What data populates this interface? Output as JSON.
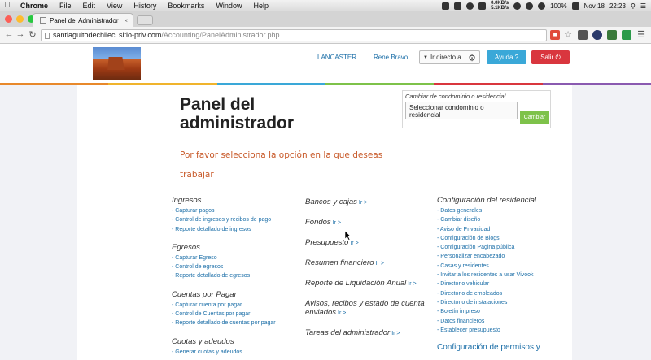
{
  "menubar": {
    "app": "Chrome",
    "items": [
      "File",
      "Edit",
      "View",
      "History",
      "Bookmarks",
      "Window",
      "Help"
    ],
    "net_up": "0.0KB/s",
    "net_down": "5.1KB/s",
    "battery": "100%",
    "date": "Nov 18",
    "time": "22:23"
  },
  "browser": {
    "tab_title": "Panel del Administrador",
    "url_host": "santiaguitodechilecl.sitio-priv.com",
    "url_path": "/Accounting/PanelAdministrador.php"
  },
  "header": {
    "link1": "LANCASTER",
    "link2": "Rene Bravo",
    "goto_label": "Ir directo a",
    "help_label": "Ayuda ?",
    "exit_label": "Salir"
  },
  "colors": {
    "stripe": [
      "#e8892b",
      "#f0b42d",
      "#3aa8d8",
      "#7ec24a",
      "#d9363e",
      "#8a5ab0"
    ]
  },
  "main": {
    "title": "Panel del administrador",
    "subtitle": "Por favor selecciona la opción en la que deseas trabajar"
  },
  "condo": {
    "label": "Cambiar de condominio o residencial",
    "select_value": "Seleccionar condominio o residencial",
    "button": "Cambiar"
  },
  "columns": {
    "left": [
      {
        "title": "Ingresos",
        "links": [
          "- Capturar pagos",
          "- Control de ingresos y recibos de pago",
          "- Reporte detallado de ingresos"
        ]
      },
      {
        "title": "Egresos",
        "links": [
          "- Capturar Egreso",
          "- Control de egresos",
          "- Reporte detallado de egresos"
        ]
      },
      {
        "title": "Cuentas por Pagar",
        "links": [
          "- Capturar cuenta por pagar",
          "- Control de Cuentas por pagar",
          "- Reporte detallado de cuentas por pagar"
        ]
      },
      {
        "title": "Cuotas y adeudos",
        "links": [
          "- Generar cuotas y adeudos"
        ]
      }
    ],
    "middle": [
      {
        "title": "Bancos y cajas",
        "ir": "Ir >"
      },
      {
        "title": "Fondos",
        "ir": "Ir >"
      },
      {
        "title": "Presupuesto",
        "ir": "Ir >"
      },
      {
        "title": "Resumen financiero",
        "ir": "Ir >"
      },
      {
        "title": "Reporte de Liquidación Anual",
        "ir": "Ir >"
      },
      {
        "title": "Avisos, recibos y estado de cuenta enviados",
        "ir": "Ir >"
      },
      {
        "title": "Tareas del administrador",
        "ir": "Ir >"
      }
    ],
    "right": {
      "title": "Configuración del residencial",
      "links": [
        "- Datos generales",
        "- Cambiar diseño",
        "- Aviso de Privacidad",
        "- Configuración de Blogs",
        "- Configuración Página pública",
        "- Personalizar encabezado",
        "- Casas y residentes",
        "- Invitar a los residentes a usar Vivook",
        "- Directorio vehicular",
        "- Directorio de empleados",
        "- Directorio de instalaciones",
        "- Boletín impreso",
        "- Datos financieros",
        "- Establecer presupuesto"
      ],
      "title2": "Configuración de permisos y"
    }
  }
}
